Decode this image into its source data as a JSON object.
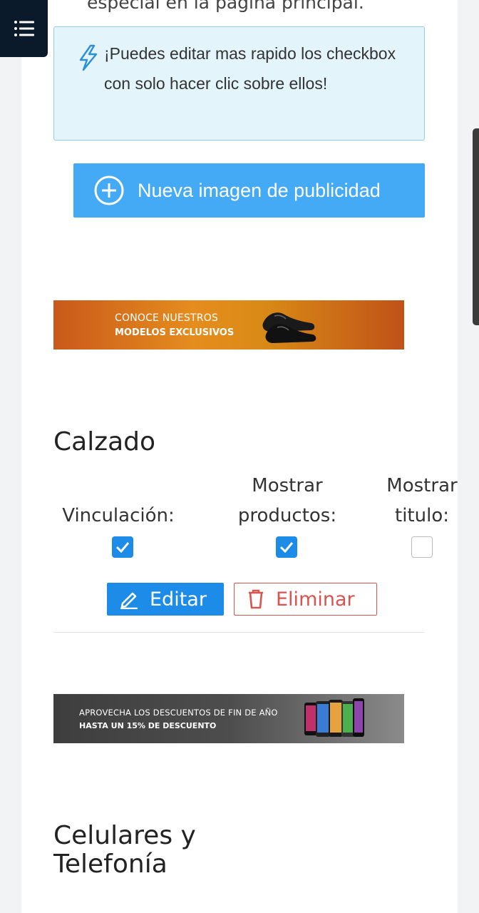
{
  "top_text": "especial en la pagina principal.",
  "tip": {
    "text": "¡Puedes editar mas rapido los checkbox con solo hacer clic sobre ellos!",
    "icon": "lightning-icon"
  },
  "new_button": {
    "label": "Nueva imagen de publicidad",
    "icon": "plus-circle-icon"
  },
  "banners": [
    {
      "line1": "CONOCE NUESTROS",
      "line2": "MODELOS EXCLUSIVOS"
    },
    {
      "line1": "APROVECHA LOS DESCUENTOS DE FIN DE AÑO",
      "line2": "HASTA UN 15% DE DESCUENTO"
    }
  ],
  "sections": [
    {
      "title": "Calzado",
      "columns": [
        {
          "label": "Vinculación:",
          "checked": true
        },
        {
          "label": "Mostrar productos:",
          "checked": true
        },
        {
          "label": "Mostrar titulo:",
          "checked": false
        }
      ],
      "edit_label": "Editar",
      "delete_label": "Eliminar"
    },
    {
      "title": "Celulares y Telefonía"
    }
  ],
  "colors": {
    "primary": "#1d8be8",
    "new_button": "#44aaf5",
    "danger": "#d9534f",
    "tip_bg": "#e3f4fb"
  }
}
